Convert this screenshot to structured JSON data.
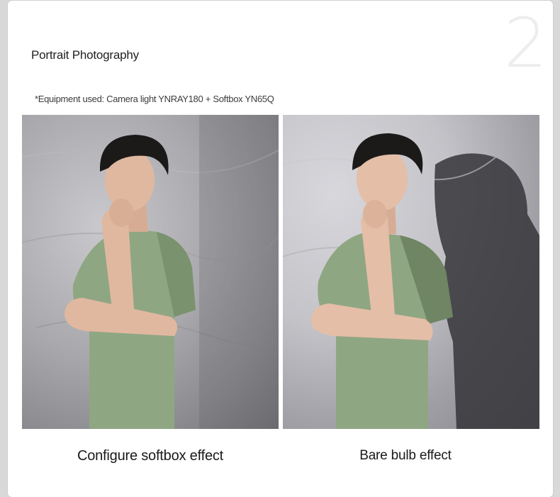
{
  "section": {
    "number": "2",
    "title": "Portrait Photography",
    "equipment_note": "*Equipment used: Camera light YNRAY180 + Softbox YN65Q"
  },
  "photos": [
    {
      "caption": "Configure softbox effect",
      "subject": "man in green t-shirt with hand on chin, soft lighting"
    },
    {
      "caption": "Bare bulb effect",
      "subject": "man in green t-shirt with hand on chin, hard shadow on backdrop"
    }
  ],
  "colors": {
    "card_background": "#ffffff",
    "page_background": "#d9d9d9",
    "shirt_green": "#8fa683",
    "hair": "#1c1a19",
    "skin": "#e0b8a0"
  }
}
